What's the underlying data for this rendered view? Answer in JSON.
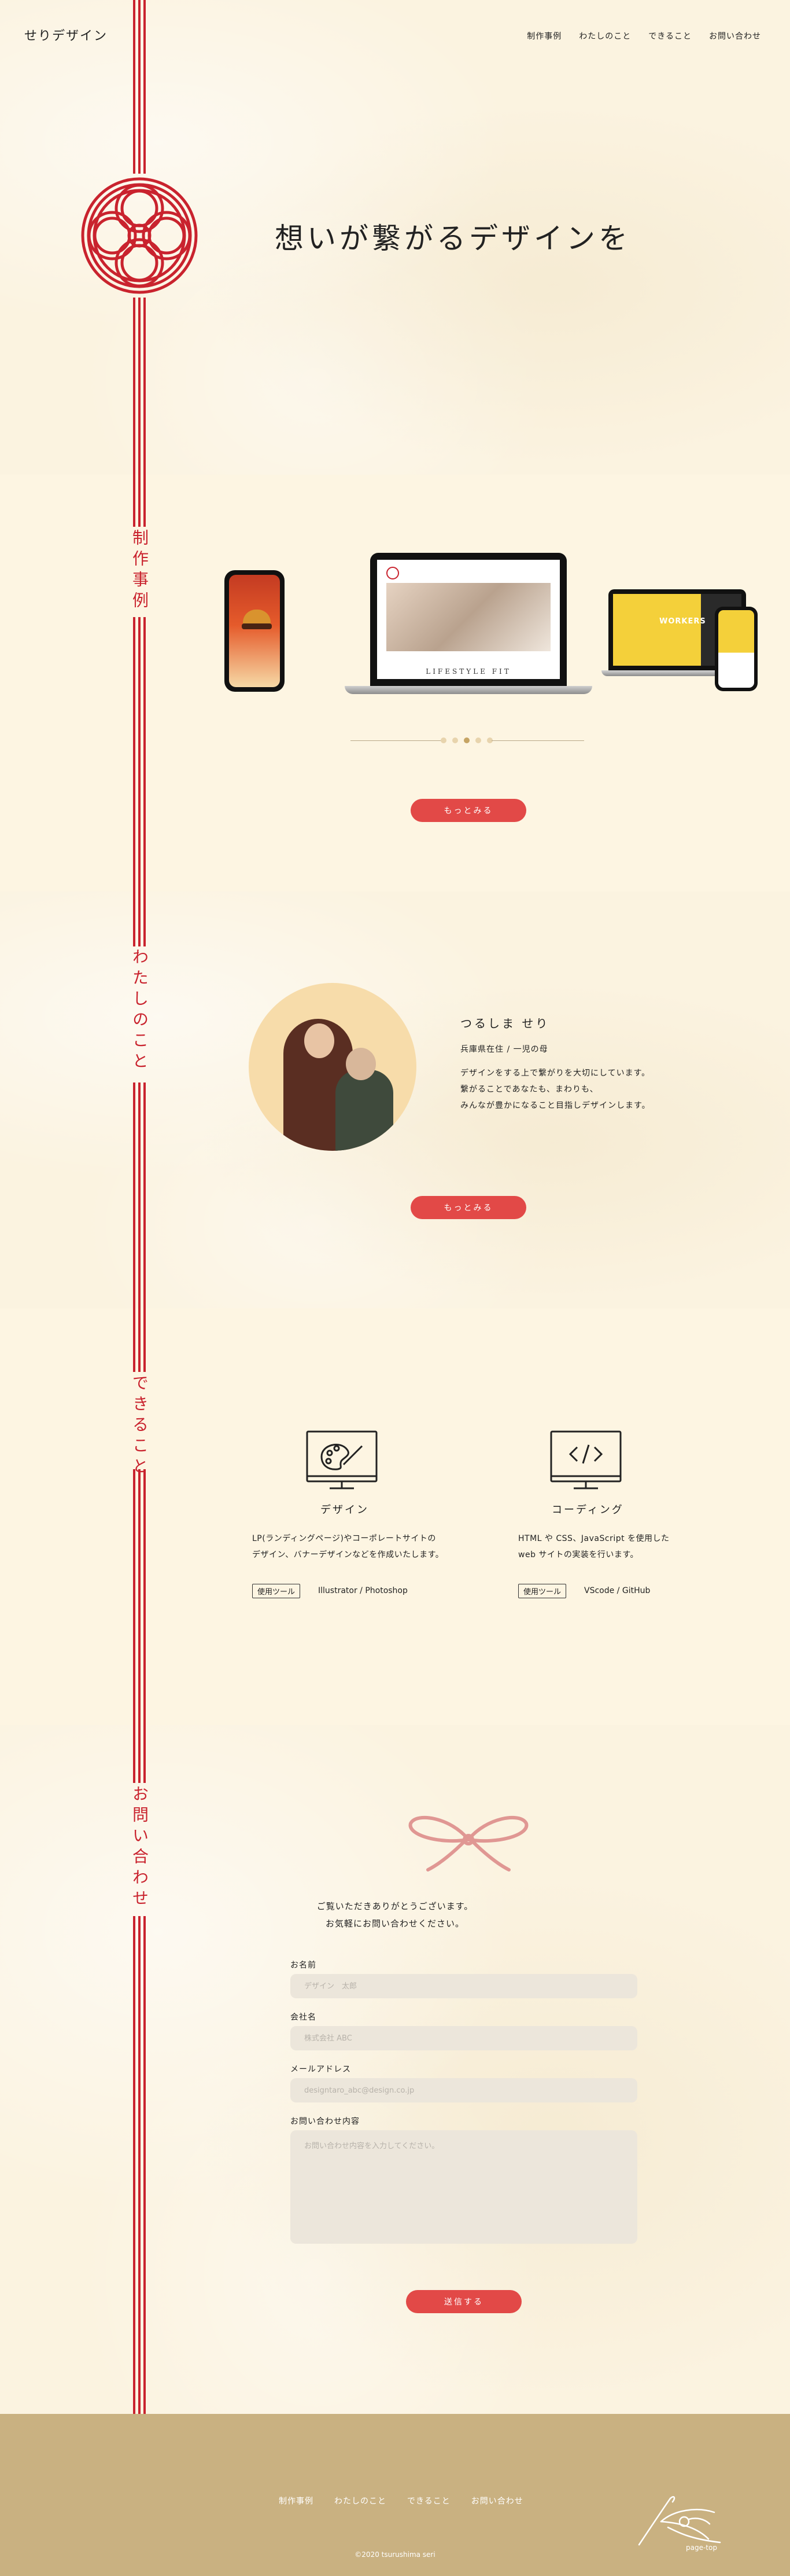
{
  "header": {
    "logo": "せりデザイン",
    "nav": [
      "制作事例",
      "わたしのこと",
      "できること",
      "お問い合わせ"
    ]
  },
  "hero": {
    "title": "想いが繋がるデザインを"
  },
  "works": {
    "label": "制作事例",
    "laptop_text": "LIFESTYLE FIT",
    "laptop2_text": "WORKERS",
    "slider_dots": 5,
    "active_dot": 3,
    "more_button": "もっとみる"
  },
  "about": {
    "label": "わたしのこと",
    "name": "つるしま せり",
    "meta": "兵庫県在住 / 一児の母",
    "desc": [
      "デザインをする上で繋がりを大切にしています。",
      "繋がることであなたも、まわりも、",
      "みんなが豊かになること目指しデザインします。"
    ],
    "more_button": "もっとみる"
  },
  "skills": {
    "label": "できること",
    "items": [
      {
        "title": "デザイン",
        "desc": [
          "LP(ランディングページ)やコーポレートサイトの",
          "デザイン、バナーデザインなどを作成いたします。"
        ],
        "tag": "使用ツール",
        "tools": "Illustrator / Photoshop"
      },
      {
        "title": "コーディング",
        "desc": [
          "HTML や CSS、JavaScript を使用した",
          "web サイトの実装を行います。"
        ],
        "tag": "使用ツール",
        "tools": "VScode / GitHub"
      }
    ]
  },
  "contact": {
    "label": "お問い合わせ",
    "message": [
      "ご覧いただきありがとうございます。",
      "お気軽にお問い合わせください。"
    ],
    "fields": {
      "name_label": "お名前",
      "name_placeholder": "デザイン　太郎",
      "company_label": "会社名",
      "company_placeholder": "株式会社 ABC",
      "email_label": "メールアドレス",
      "email_placeholder": "designtaro_abc@design.co.jp",
      "message_label": "お問い合わせ内容",
      "message_placeholder": "お問い合わせ内容を入力してください。"
    },
    "submit": "送信する"
  },
  "footer": {
    "nav": [
      "制作事例",
      "わたしのこと",
      "できること",
      "お問い合わせ"
    ],
    "page_top": "page-top",
    "copyright": "©2020 tsurushima seri"
  },
  "colors": {
    "cord_red": "#c9232e",
    "button_red": "#e24947",
    "footer_bg": "#c9b181",
    "paper_bg": "#fbf3e0"
  }
}
